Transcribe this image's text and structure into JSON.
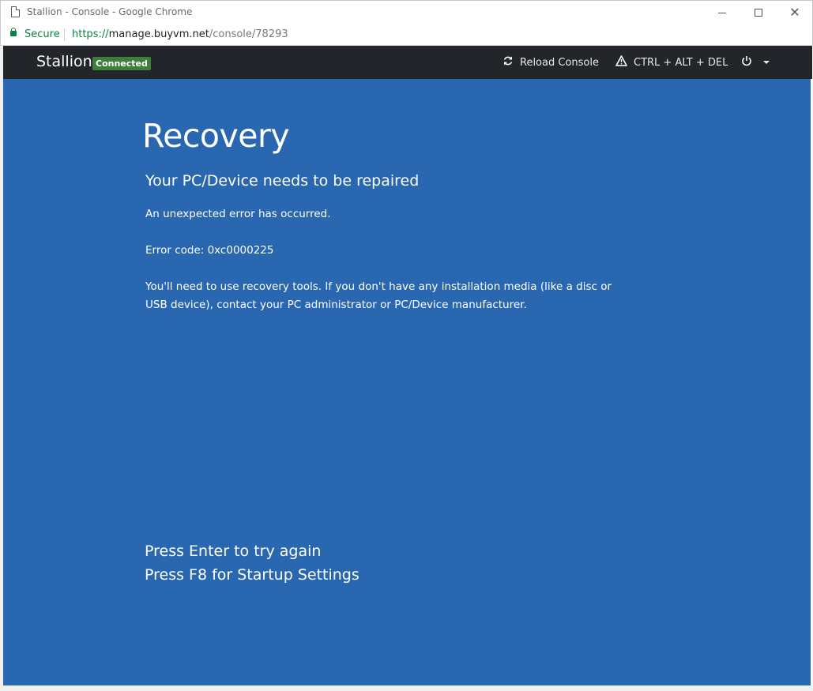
{
  "window": {
    "title": "Stallion - Console - Google Chrome"
  },
  "addressbar": {
    "secure_label": "Secure",
    "url_scheme": "https://",
    "url_host": "manage.buyvm.net",
    "url_path": "/console/78293"
  },
  "navbar": {
    "brand": "Stallion",
    "status": "Connected",
    "reload_label": "Reload Console",
    "cad_label": "CTRL + ALT + DEL"
  },
  "console": {
    "title": "Recovery",
    "subtitle": "Your PC/Device needs to be repaired",
    "line1": "An unexpected error has occurred.",
    "line2": "Error code: 0xc0000225",
    "line3": "You'll need to use recovery tools. If you don't have any installation media (like a disc or USB device), contact your PC administrator or PC/Device manufacturer.",
    "key1": "Press Enter to try again",
    "key2": "Press F8 for Startup Settings"
  },
  "colors": {
    "console_bg": "#2a67b1",
    "navbar_bg": "#22262b",
    "badge_bg": "#3f7d3a",
    "secure_green": "#0b8043"
  },
  "icons": [
    "page-icon",
    "lock-icon",
    "reload-icon",
    "warning-icon",
    "power-icon",
    "caret-down-icon"
  ]
}
